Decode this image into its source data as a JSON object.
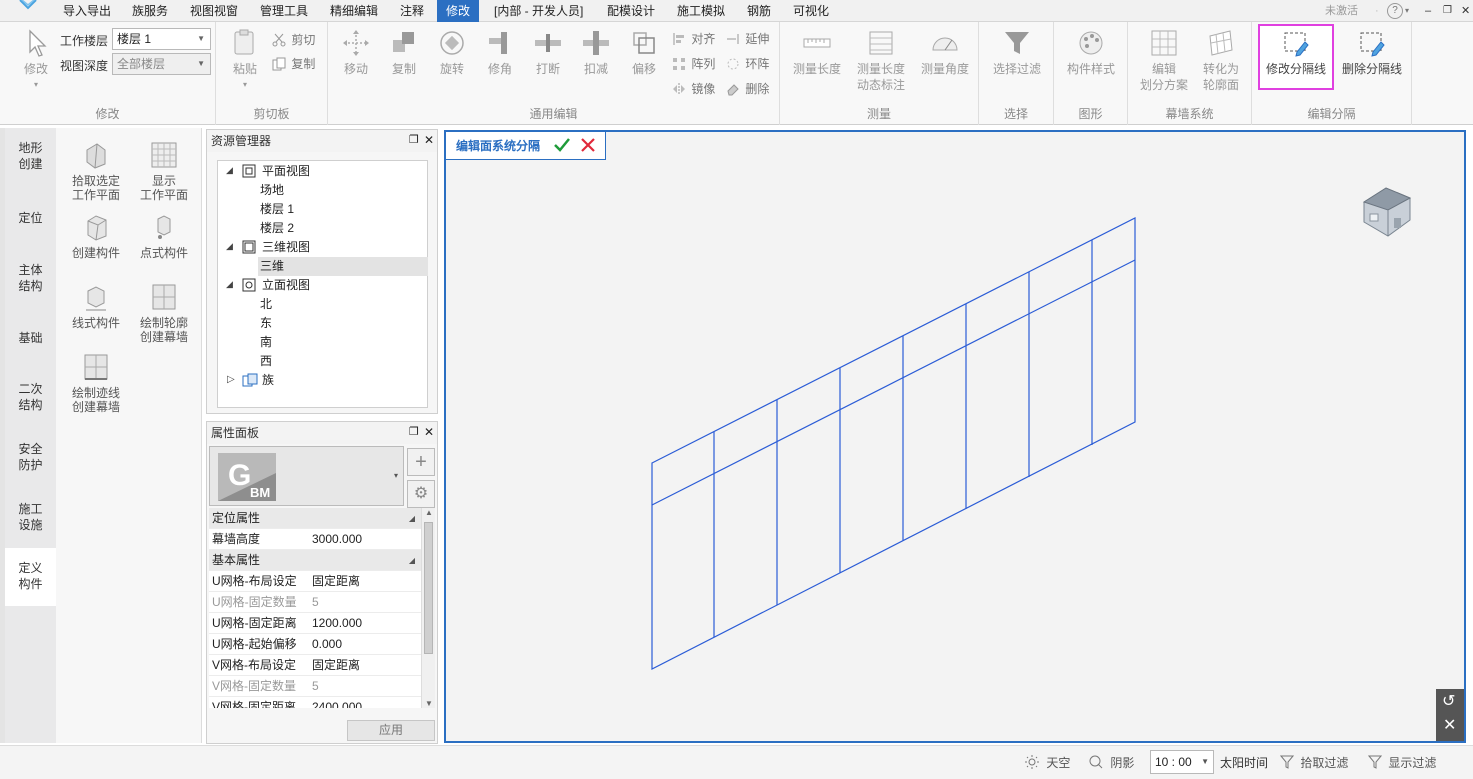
{
  "menubar": {
    "items": [
      "导入导出",
      "族服务",
      "视图视窗",
      "管理工具",
      "精细编辑",
      "注释",
      "修改",
      "[内部 - 开发人员]",
      "配模设计",
      "施工模拟",
      "钢筋",
      "可视化"
    ],
    "active": "修改",
    "right_status": "未激活",
    "help_symbol": "?"
  },
  "ribbon": {
    "modify": {
      "button": "修改",
      "work_floor_label": "工作楼层",
      "work_floor_value": "楼层 1",
      "view_depth_label": "视图深度",
      "view_depth_value": "全部楼层",
      "group": "修改"
    },
    "clipboard": {
      "paste": "粘贴",
      "cut": "剪切",
      "copy": "复制",
      "group": "剪切板"
    },
    "general_edit": {
      "move": "移动",
      "copy": "复制",
      "rotate": "旋转",
      "trim": "修角",
      "break": "打断",
      "subtract": "扣减",
      "offset": "偏移",
      "align": "对齐",
      "array": "阵列",
      "mirror": "镜像",
      "extend": "延伸",
      "ring_array": "环阵",
      "delete": "删除",
      "group": "通用编辑"
    },
    "measure": {
      "length": "测量长度",
      "length_dynamic_1": "测量长度",
      "length_dynamic_2": "动态标注",
      "angle": "测量角度",
      "group": "测量"
    },
    "select": {
      "filter": "选择过滤",
      "group": "选择"
    },
    "graphics": {
      "style": "构件样式",
      "group": "图形"
    },
    "curtain": {
      "edit_1": "编辑",
      "edit_2": "划分方案",
      "convert_1": "转化为",
      "convert_2": "轮廓面",
      "group": "幕墙系统"
    },
    "divider": {
      "modify": "修改分隔线",
      "delete": "删除分隔线",
      "group": "编辑分隔"
    }
  },
  "left_tabs": [
    {
      "l1": "地形",
      "l2": "创建"
    },
    {
      "l1": "定位",
      "l2": ""
    },
    {
      "l1": "主体",
      "l2": "结构"
    },
    {
      "l1": "基础",
      "l2": ""
    },
    {
      "l1": "二次",
      "l2": "结构"
    },
    {
      "l1": "安全",
      "l2": "防护"
    },
    {
      "l1": "施工",
      "l2": "设施"
    },
    {
      "l1": "定义",
      "l2": "构件"
    }
  ],
  "palette": {
    "pick_plane": {
      "l1": "拾取选定",
      "l2": "工作平面"
    },
    "show_plane": {
      "l1": "显示",
      "l2": "工作平面"
    },
    "create_component": {
      "l1": "创建构件",
      "l2": ""
    },
    "point_component": {
      "l1": "点式构件",
      "l2": ""
    },
    "line_component": {
      "l1": "线式构件",
      "l2": ""
    },
    "draw_outline": {
      "l1": "绘制轮廓",
      "l2": "创建幕墙"
    },
    "draw_trace": {
      "l1": "绘制迹线",
      "l2": "创建幕墙"
    }
  },
  "explorer": {
    "title": "资源管理器",
    "plan_view": "平面视图",
    "plan_items": [
      "场地",
      "楼层 1",
      "楼层 2"
    ],
    "view_3d": "三维视图",
    "items_3d": [
      "三维"
    ],
    "elevation_view": "立面视图",
    "elevation_items": [
      "北",
      "东",
      "南",
      "西"
    ],
    "family": "族"
  },
  "properties": {
    "title": "属性面板",
    "logo_text": "BM",
    "section_position": "定位属性",
    "curtain_height_label": "幕墙高度",
    "curtain_height_value": "3000.000",
    "section_basic": "基本属性",
    "rows": [
      {
        "name": "U网格-布局设定",
        "value": "固定距离"
      },
      {
        "name": "U网格-固定数量",
        "value": "5"
      },
      {
        "name": "U网格-固定距离",
        "value": "1200.000"
      },
      {
        "name": "U网格-起始偏移",
        "value": "0.000"
      },
      {
        "name": "V网格-布局设定",
        "value": "固定距离"
      },
      {
        "name": "V网格-固定数量",
        "value": "5"
      },
      {
        "name": "V网格-固定距离",
        "value": "2400.000"
      }
    ],
    "apply": "应用"
  },
  "viewport": {
    "mode_label": "编辑面系统分隔",
    "grid_color": "#2b5cd6",
    "border_color": "#2b6fc2"
  },
  "statusbar": {
    "sky": "天空",
    "shadow": "阴影",
    "time": "10 : 00",
    "sun_time": "太阳时间",
    "pick_filter": "拾取过滤",
    "display_filter": "显示过滤"
  },
  "colors": {
    "accent": "#2b6fc2",
    "highlight_outline": "#e040e0",
    "confirm": "#1f9b3a",
    "cancel": "#e0283a"
  }
}
